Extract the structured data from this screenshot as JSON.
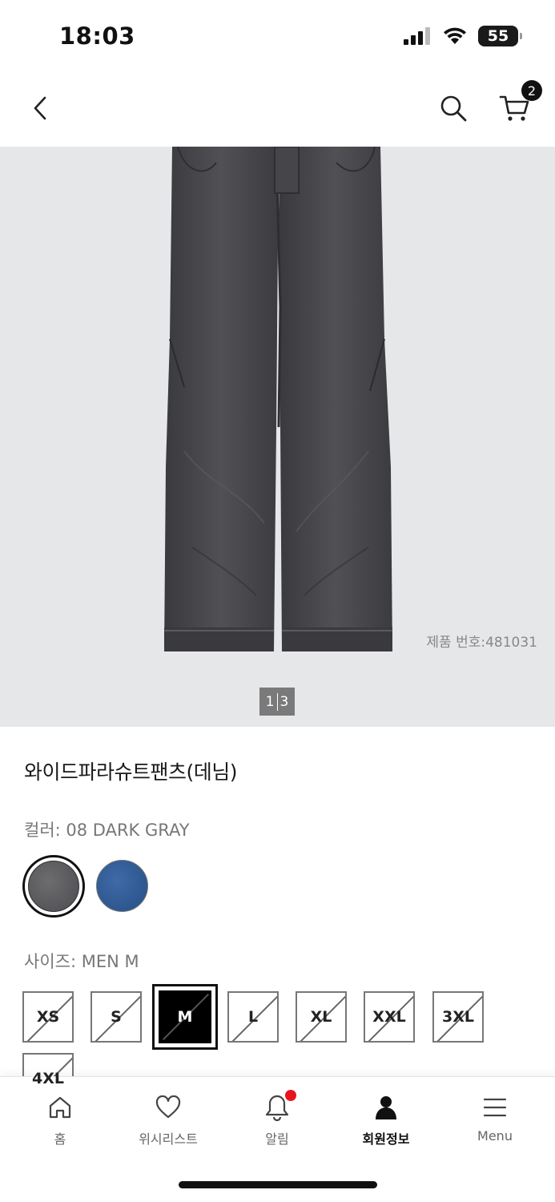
{
  "status_bar": {
    "time": "18:03",
    "battery": "55"
  },
  "header": {
    "cart_count": "2"
  },
  "gallery": {
    "product_code": "제품 번호:481031",
    "pager_current": "1",
    "pager_total": "3"
  },
  "product": {
    "title": "와이드파라슈트팬츠(데님)",
    "color_label": "컬러: 08 DARK GRAY",
    "size_label": "사이즈: MEN M",
    "swatches": [
      "dark-gray",
      "blue"
    ],
    "sizes": [
      "XS",
      "S",
      "M",
      "L",
      "XL",
      "XXL",
      "3XL",
      "4XL"
    ],
    "selected_size": "M"
  },
  "bottom_nav": {
    "items": [
      {
        "label": "홈",
        "icon": "home-icon"
      },
      {
        "label": "위시리스트",
        "icon": "heart-icon"
      },
      {
        "label": "알림",
        "icon": "bell-icon"
      },
      {
        "label": "회원정보",
        "icon": "user-icon"
      },
      {
        "label": "Menu",
        "icon": "hamburger-icon"
      }
    ]
  },
  "colors": {
    "notification_dot": "#e8141c",
    "gallery_bg": "#e6e7e9",
    "selected_size_bg": "#000000"
  }
}
